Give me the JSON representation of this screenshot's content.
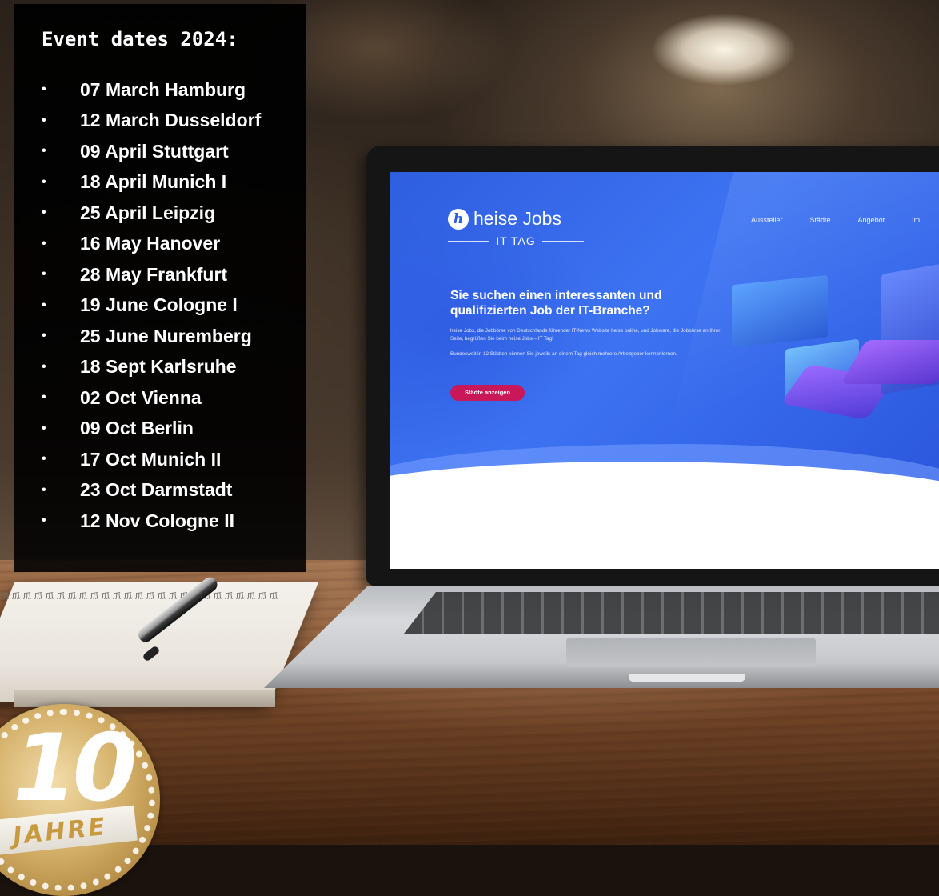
{
  "event_panel": {
    "title": "Event dates 2024:",
    "bullet": "•",
    "events": [
      "07 March Hamburg",
      "12 March Dusseldorf",
      "09 April Stuttgart",
      "18 April Munich I",
      "25 April Leipzig",
      "16 May Hanover",
      "28 May Frankfurt",
      "19 June Cologne I",
      "25 June Nuremberg",
      "18 Sept Karlsruhe",
      "02 Oct Vienna",
      "09 Oct Berlin",
      "17 Oct Munich II",
      "23 Oct Darmstadt",
      "12 Nov Cologne II"
    ]
  },
  "website": {
    "logo_mark": "h",
    "logo_text": "heise Jobs",
    "logo_sub": "IT TAG",
    "nav": [
      "Aussteller",
      "Städte",
      "Angebot",
      "Im"
    ],
    "hero_title": "Sie suchen einen interessanten und qualifizierten Job der IT-Branche?",
    "hero_paragraph_1": "heise Jobs, die Jobbörse von Deutschlands führender IT-News Website heise online, und Jobware, die Jobbörse an Ihrer Seite, begrüßen Sie beim heise Jobs – IT Tag!",
    "hero_paragraph_2": "Bundesweit in 12 Städten können Sie jeweils an einem Tag gleich mehrere Arbeitgeber kennenlernen.",
    "cta_label": "Städte anzeigen",
    "colors": {
      "hero_blue": "#3d73f2",
      "cta": "#c8185a"
    }
  },
  "badge": {
    "number": "10",
    "label": "JAHRE",
    "color": "#d4b069"
  }
}
